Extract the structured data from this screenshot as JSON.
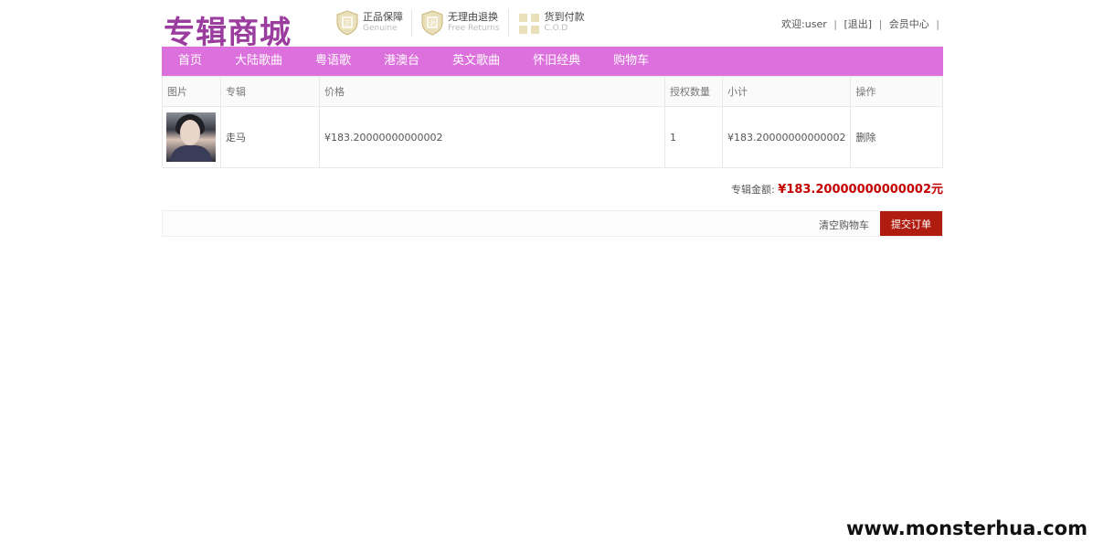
{
  "header": {
    "logo_text": "专辑商城",
    "badges": [
      {
        "main": "正品保障",
        "sub": "Genuine",
        "icon": "shield-genuine-icon"
      },
      {
        "main": "无理由退换",
        "sub": "Free Returns",
        "icon": "shield-return-icon"
      },
      {
        "main": "货到付款",
        "sub": "C.O.D",
        "icon": "gift-box-icon"
      }
    ],
    "user": {
      "welcome": "欢迎:user",
      "logout": "[退出]",
      "member_center": "会员中心"
    }
  },
  "nav": {
    "items": [
      "首页",
      "大陆歌曲",
      "粤语歌",
      "港澳台",
      "英文歌曲",
      "怀旧经典",
      "购物车"
    ],
    "color": "#dc70dc"
  },
  "cart": {
    "columns": [
      "图片",
      "专辑",
      "价格",
      "授权数量",
      "小计",
      "操作"
    ],
    "rows": [
      {
        "album": "走马",
        "price": "¥183.20000000000002",
        "quantity": "1",
        "subtotal": "¥183.20000000000002",
        "action": "删除"
      }
    ]
  },
  "summary": {
    "label": "专辑金额:",
    "amount": "¥183.20000000000002元"
  },
  "actions": {
    "clear": "清空购物车",
    "submit": "提交订单",
    "submit_color": "#b01c10"
  },
  "watermark": "www.monsterhua.com"
}
